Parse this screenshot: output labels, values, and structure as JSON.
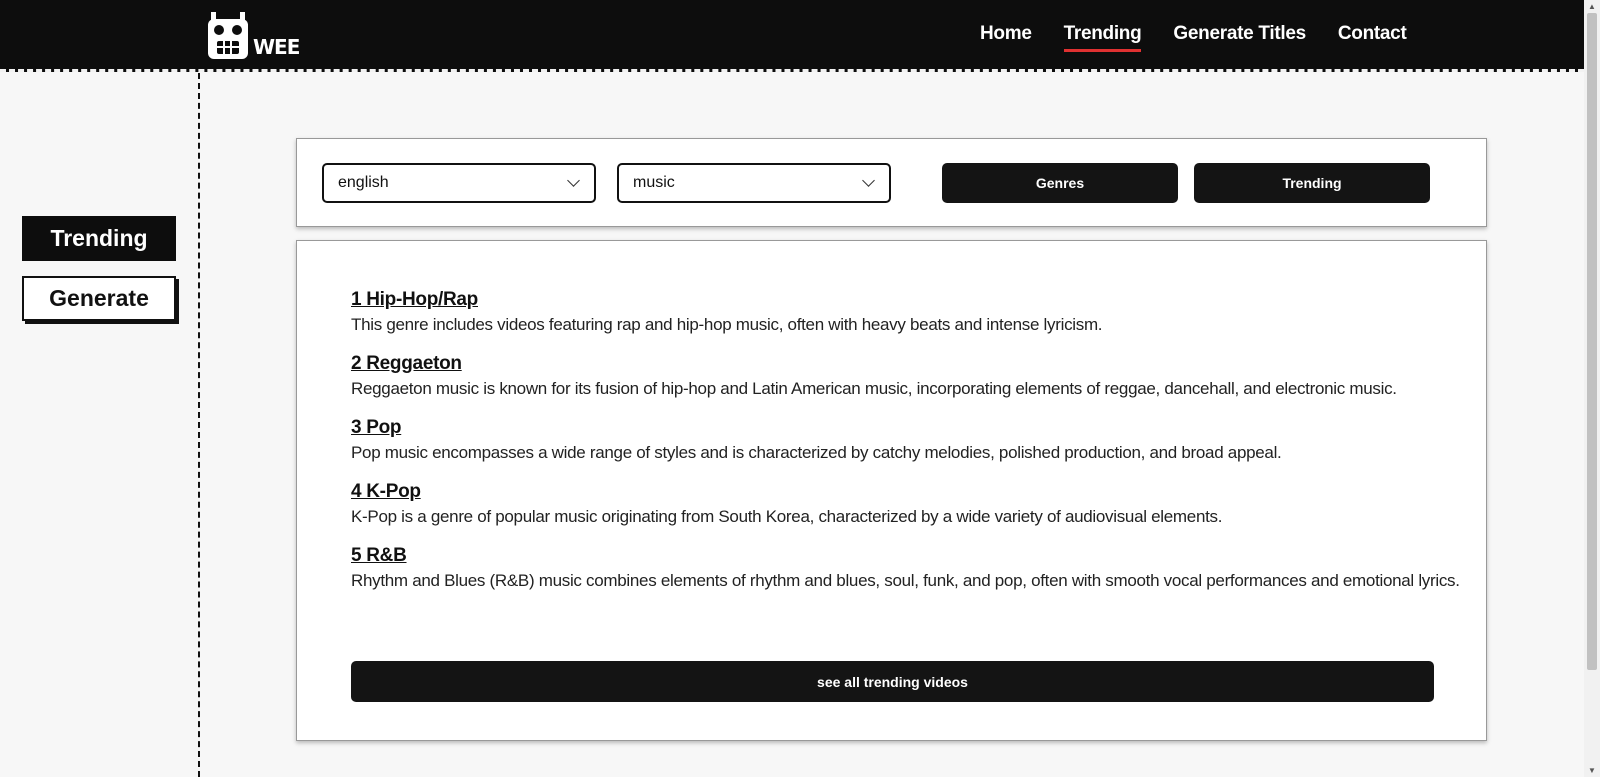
{
  "header": {
    "logo_text": "WEE",
    "nav": [
      {
        "label": "Home",
        "active": false
      },
      {
        "label": "Trending",
        "active": true
      },
      {
        "label": "Generate Titles",
        "active": false
      },
      {
        "label": "Contact",
        "active": false
      }
    ]
  },
  "sidebar": {
    "trending_label": "Trending",
    "generate_label": "Generate"
  },
  "filters": {
    "language": "english",
    "category": "music",
    "genres_button": "Genres",
    "trending_button": "Trending"
  },
  "genres": [
    {
      "title": "1 Hip-Hop/Rap",
      "description": "This genre includes videos featuring rap and hip-hop music, often with heavy beats and intense lyricism."
    },
    {
      "title": "2 Reggaeton",
      "description": "Reggaeton music is known for its fusion of hip-hop and Latin American music, incorporating elements of reggae, dancehall, and electronic music."
    },
    {
      "title": "3 Pop",
      "description": "Pop music encompasses a wide range of styles and is characterized by catchy melodies, polished production, and broad appeal."
    },
    {
      "title": "4 K-Pop",
      "description": "K-Pop is a genre of popular music originating from South Korea, characterized by a wide variety of audiovisual elements."
    },
    {
      "title": "5 R&B",
      "description": "Rhythm and Blues (R&B) music combines elements of rhythm and blues, soul, funk, and pop, often with smooth vocal performances and emotional lyrics."
    }
  ],
  "see_all_label": "see all trending videos",
  "colors": {
    "header_bg": "#0d0d0d",
    "active_underline": "#e03131",
    "button_bg": "#141414"
  }
}
